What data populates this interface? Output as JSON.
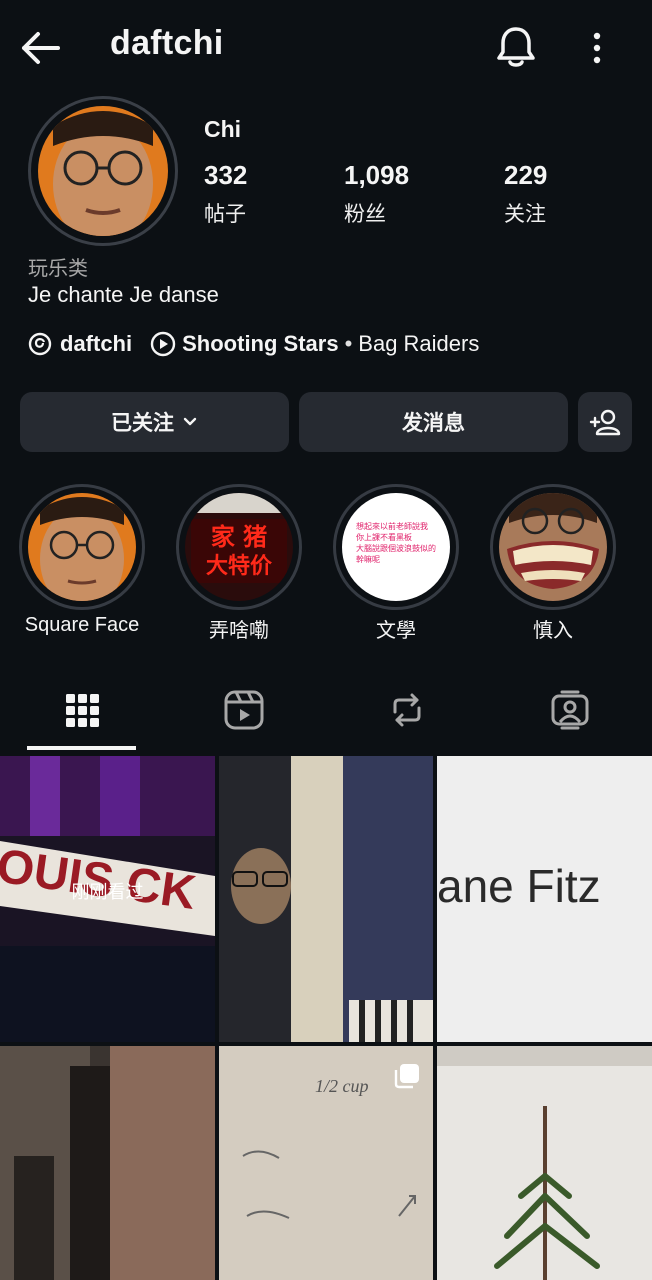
{
  "header": {
    "username": "daftchi",
    "back_icon": "arrow-left-icon",
    "bell_icon": "bell-icon",
    "more_icon": "more-vertical-icon"
  },
  "profile": {
    "display_name": "Chi",
    "stats": [
      {
        "count": "332",
        "label": "帖子"
      },
      {
        "count": "1,098",
        "label": "粉丝"
      },
      {
        "count": "229",
        "label": "关注"
      }
    ],
    "category": "玩乐类",
    "bio": "Je chante Je danse",
    "threads_handle": "daftchi",
    "music": {
      "song": "Shooting Stars",
      "separator": "•",
      "artist": "Bag Raiders"
    }
  },
  "actions": {
    "follow_label": "已关注",
    "message_label": "发消息"
  },
  "highlights": [
    {
      "label": "Square Face"
    },
    {
      "label": "弄啥嘞"
    },
    {
      "label": "文學"
    },
    {
      "label": "慎入"
    }
  ],
  "highlight_texts": {
    "sign": "家 猪 大特价",
    "note": "想起來以前老師說我 你上課不看黑板 大腦說跟個波浪鼓似的 幹嘛呢"
  },
  "tabs": [
    {
      "icon": "grid-icon",
      "active": true
    },
    {
      "icon": "reels-icon",
      "active": false
    },
    {
      "icon": "reposts-icon",
      "active": false
    },
    {
      "icon": "tagged-icon",
      "active": false
    }
  ],
  "grid": {
    "posts": [
      {
        "overlay": "刚刚看过",
        "sign_text": "OUIS CK"
      },
      {
        "overlay": ""
      },
      {
        "overlay": "",
        "sign_text": "ane Fitz"
      },
      {
        "overlay": ""
      },
      {
        "overlay": "",
        "note_text": "1/2 cup"
      },
      {
        "overlay": ""
      }
    ]
  },
  "colors": {
    "background": "#0c1014",
    "button": "#262a31",
    "muted_text": "#a8a8a8"
  }
}
